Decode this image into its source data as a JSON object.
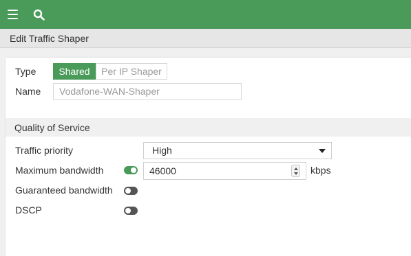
{
  "topbar": {
    "menu_icon": "hamburger-menu-icon",
    "search_icon": "search-icon",
    "color": "#4a9a5a"
  },
  "page": {
    "title": "Edit Traffic Shaper"
  },
  "form": {
    "type": {
      "label": "Type",
      "options": [
        "Shared",
        "Per IP Shaper"
      ],
      "selected": "Shared"
    },
    "name": {
      "label": "Name",
      "value": "Vodafone-WAN-Shaper"
    },
    "qos": {
      "section_title": "Quality of Service",
      "traffic_priority": {
        "label": "Traffic priority",
        "value": "High"
      },
      "max_bandwidth": {
        "label": "Maximum bandwidth",
        "enabled": true,
        "value": "46000",
        "unit": "kbps"
      },
      "guaranteed_bandwidth": {
        "label": "Guaranteed bandwidth",
        "enabled": false
      },
      "dscp": {
        "label": "DSCP",
        "enabled": false
      }
    }
  },
  "colors": {
    "accent": "#4a9a5a",
    "toggle_off": "#555555"
  }
}
